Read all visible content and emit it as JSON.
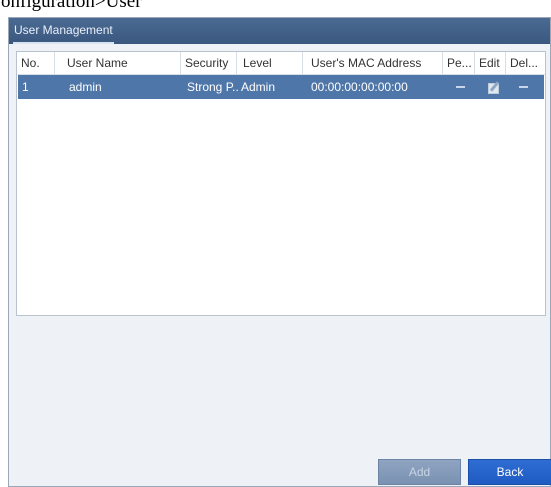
{
  "page_header_clip": "onfiguration>User",
  "window": {
    "tab_label": "User Management"
  },
  "table": {
    "columns": [
      "No.",
      "User Name",
      "Security",
      "Level",
      "User's MAC Address",
      "Pe...",
      "Edit",
      "Del..."
    ],
    "rows": [
      {
        "no": "1",
        "user_name": "admin",
        "security": "Strong P...",
        "level": "Admin",
        "mac": "00:00:00:00:00:00",
        "permission_icon": "dash-icon",
        "edit_icon": "edit-pencil-icon",
        "delete_icon": "dash-icon"
      }
    ]
  },
  "buttons": {
    "add": "Add",
    "back": "Back"
  },
  "colors": {
    "titlebar": "#3f5f88",
    "selected_row": "#4e76a8",
    "back_button": "#2563c9",
    "add_button_disabled": "#8399b8"
  }
}
